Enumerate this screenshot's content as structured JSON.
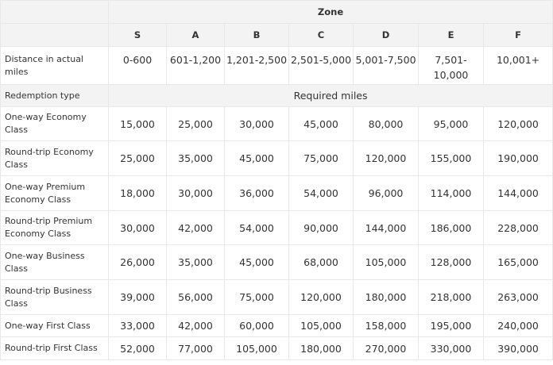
{
  "table": {
    "group_header": "Zone",
    "zones": [
      "S",
      "A",
      "B",
      "C",
      "D",
      "E",
      "F"
    ],
    "distance_row": {
      "label": "Distance in actual miles",
      "values": [
        "0-600",
        "601-1,200",
        "1,201-2,500",
        "2,501-5,000",
        "5,001-7,500",
        "7,501-10,000",
        "10,001+"
      ]
    },
    "redemption_row": {
      "label": "Redemption type",
      "value": "Required miles"
    },
    "rows": [
      {
        "label": "One-way Economy Class",
        "values": [
          "15,000",
          "25,000",
          "30,000",
          "45,000",
          "80,000",
          "95,000",
          "120,000"
        ]
      },
      {
        "label": "Round-trip Economy Class",
        "values": [
          "25,000",
          "35,000",
          "45,000",
          "75,000",
          "120,000",
          "155,000",
          "190,000"
        ]
      },
      {
        "label": "One-way Premium Economy Class",
        "values": [
          "18,000",
          "30,000",
          "36,000",
          "54,000",
          "96,000",
          "114,000",
          "144,000"
        ]
      },
      {
        "label": "Round-trip Premium Economy Class",
        "values": [
          "30,000",
          "42,000",
          "54,000",
          "90,000",
          "144,000",
          "186,000",
          "228,000"
        ]
      },
      {
        "label": "One-way Business Class",
        "values": [
          "26,000",
          "35,000",
          "45,000",
          "68,000",
          "105,000",
          "128,000",
          "165,000"
        ]
      },
      {
        "label": "Round-trip Business Class",
        "values": [
          "39,000",
          "56,000",
          "75,000",
          "120,000",
          "180,000",
          "218,000",
          "263,000"
        ]
      },
      {
        "label": "One-way First Class",
        "values": [
          "33,000",
          "42,000",
          "60,000",
          "105,000",
          "158,000",
          "195,000",
          "240,000"
        ]
      },
      {
        "label": "Round-trip First Class",
        "values": [
          "52,000",
          "77,000",
          "105,000",
          "180,000",
          "270,000",
          "330,000",
          "390,000"
        ]
      }
    ]
  }
}
